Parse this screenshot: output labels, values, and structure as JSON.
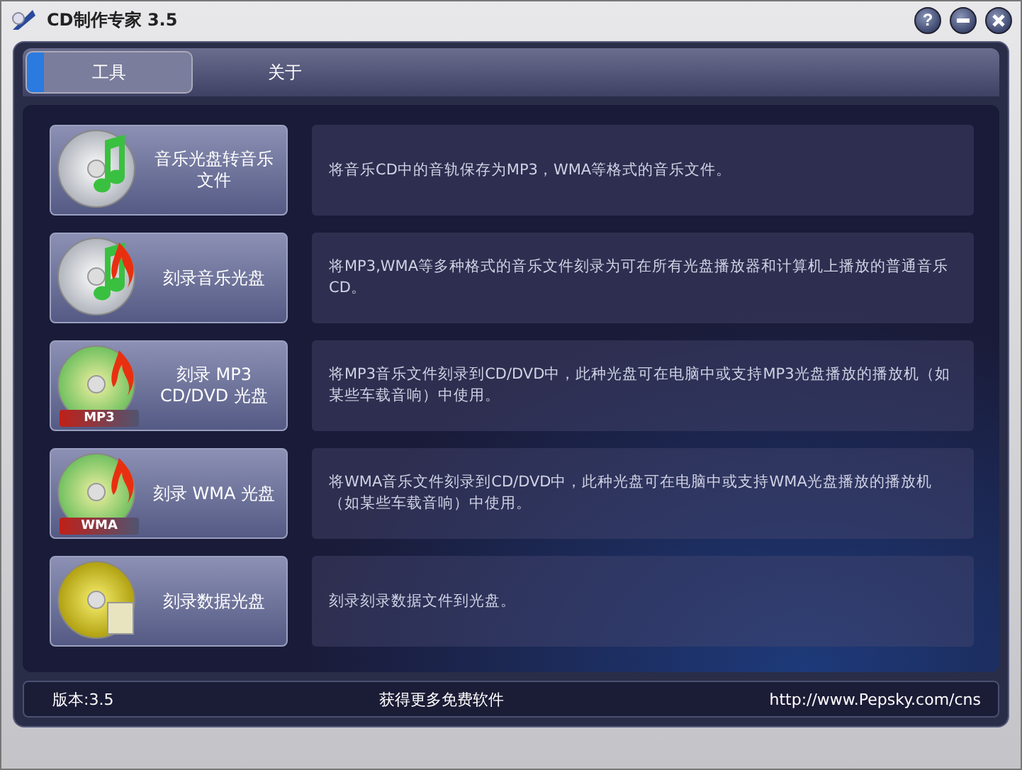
{
  "window": {
    "title": "CD制作专家 3.5",
    "controls": [
      {
        "kind": "help",
        "label": "?"
      },
      {
        "kind": "minimize"
      },
      {
        "kind": "close"
      }
    ]
  },
  "tabs": [
    {
      "label": "工具",
      "selected": true
    },
    {
      "label": "关于",
      "selected": false
    }
  ],
  "tools": [
    {
      "label": "音乐光盘转音乐文件",
      "kind": "rip",
      "description": "将音乐CD中的音轨保存为MP3，WMA等格式的音乐文件。"
    },
    {
      "label": "刻录音乐光盘",
      "kind": "audio",
      "description": "将MP3,WMA等多种格式的音乐文件刻录为可在所有光盘播放器和计算机上播放的普通音乐CD。"
    },
    {
      "label": "刻录 MP3 CD/DVD 光盘",
      "kind": "burn",
      "badge": "MP3",
      "description": "将MP3音乐文件刻录到CD/DVD中，此种光盘可在电脑中或支持MP3光盘播放的播放机（如某些车载音响）中使用。"
    },
    {
      "label": "刻录 WMA 光盘",
      "kind": "burn",
      "badge": "WMA",
      "description": "将WMA音乐文件刻录到CD/DVD中，此种光盘可在电脑中或支持WMA光盘播放的播放机（如某些车载音响）中使用。"
    },
    {
      "label": "刻录数据光盘",
      "kind": "data",
      "description": "刻录刻录数据文件到光盘。"
    }
  ],
  "status_bar": {
    "version": "版本:3.5",
    "link": "获得更多免费软件",
    "url": "http://www.Pepsky.com/cns"
  }
}
